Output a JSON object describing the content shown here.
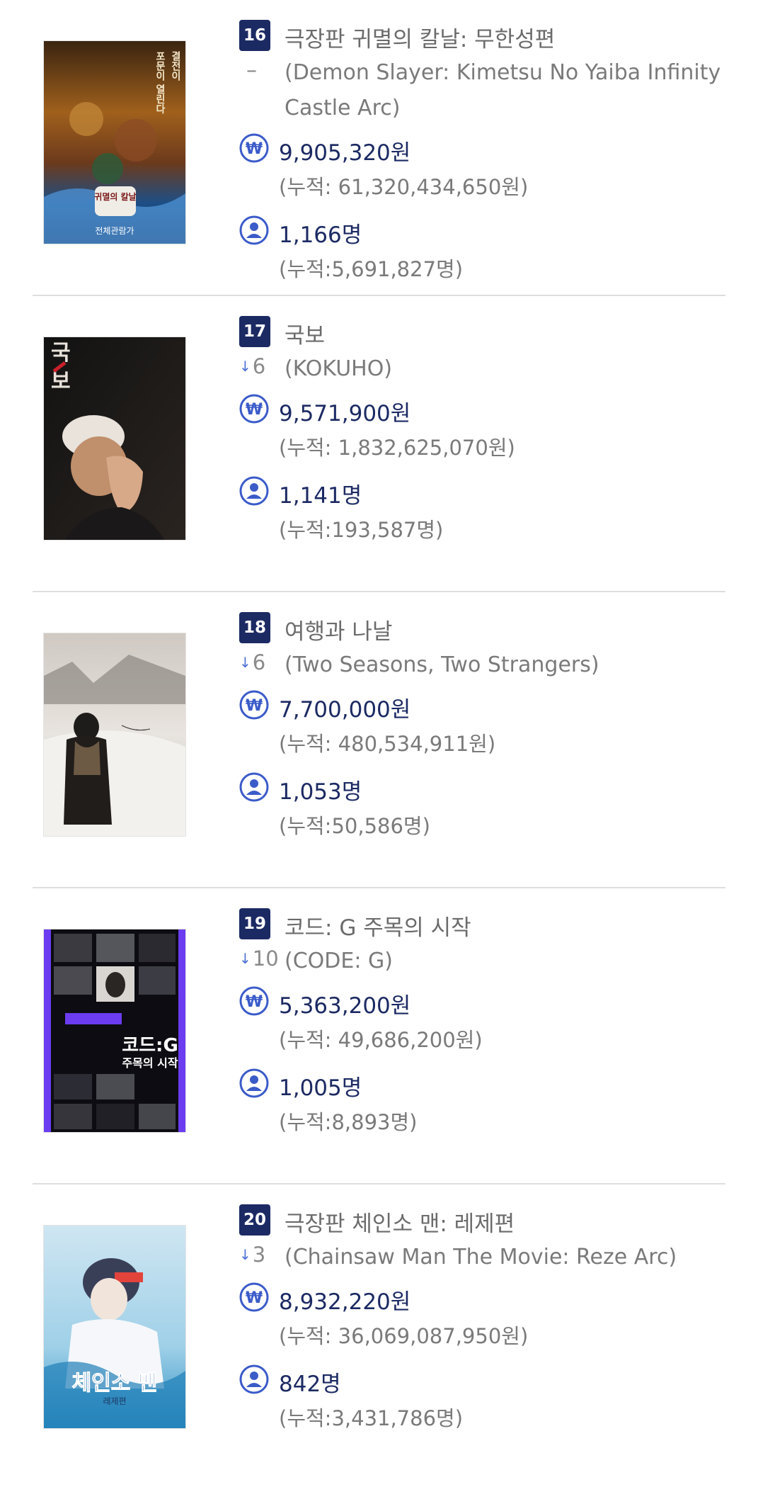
{
  "movies": [
    {
      "rank": "16",
      "title": "극장판 귀멸의 칼날: 무한성편",
      "change": "–",
      "change_dir": "none",
      "original_title": "(Demon Slayer: Kimetsu No Yaiba Infinity Castle Arc)",
      "revenue": "9,905,320원",
      "revenue_total": "(누적: 61,320,434,650원)",
      "audience": "1,166명",
      "audience_total": "(누적:5,691,827명)",
      "poster_text": [
        "결전이",
        "포문이 열린다",
        "귀멸의 칼날",
        "전체관람가"
      ]
    },
    {
      "rank": "17",
      "title": "국보",
      "change": "6",
      "change_dir": "down",
      "original_title": "(KOKUHO)",
      "revenue": "9,571,900원",
      "revenue_total": "(누적: 1,832,625,070원)",
      "audience": "1,141명",
      "audience_total": "(누적:193,587명)",
      "poster_text": [
        "국",
        "보"
      ]
    },
    {
      "rank": "18",
      "title": "여행과 나날",
      "change": "6",
      "change_dir": "down",
      "original_title": "(Two Seasons, Two Strangers)",
      "revenue": "7,700,000원",
      "revenue_total": "(누적: 480,534,911원)",
      "audience": "1,053명",
      "audience_total": "(누적:50,586명)",
      "poster_text": []
    },
    {
      "rank": "19",
      "title": "코드: G 주목의 시작",
      "change": "10",
      "change_dir": "down",
      "original_title": "(CODE: G)",
      "revenue": "5,363,200원",
      "revenue_total": "(누적: 49,686,200원)",
      "audience": "1,005명",
      "audience_total": "(누적:8,893명)",
      "poster_text": [
        "코드:G",
        "주목의 시작"
      ]
    },
    {
      "rank": "20",
      "title": "극장판 체인소 맨: 레제편",
      "change": "3",
      "change_dir": "down",
      "original_title": "(Chainsaw Man The Movie: Reze Arc)",
      "revenue": "8,932,220원",
      "revenue_total": "(누적: 36,069,087,950원)",
      "audience": "842명",
      "audience_total": "(누적:3,431,786명)",
      "poster_text": [
        "체인소 맨",
        "레제편"
      ]
    }
  ],
  "icons": {
    "revenue": "won-icon",
    "audience": "person-icon",
    "change_down": "arrow-down-icon"
  },
  "colors": {
    "accent": "#1c2a63",
    "icon_blue": "#3b5bc9",
    "arrow_blue": "#4a6fd6",
    "divider": "#dedede"
  }
}
